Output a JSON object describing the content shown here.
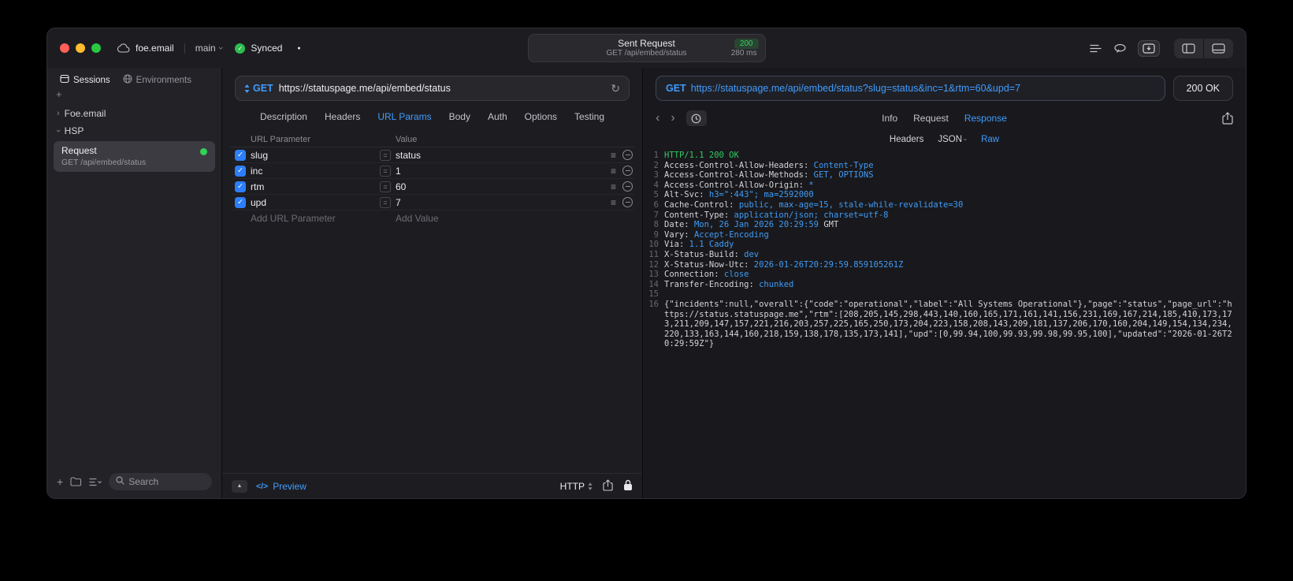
{
  "icons": {
    "plus": "+",
    "check": "✓",
    "chevron": "›",
    "refresh": "↻",
    "hamburger": "≡",
    "code": "</>",
    "collapse": "▲",
    "dot": "●",
    "equals": "="
  },
  "titlebar": {
    "project": "foe.email",
    "branch": "main",
    "sync_status": "Synced",
    "center": {
      "title": "Sent Request",
      "status_code": "200",
      "subtitle": "GET /api/embed/status",
      "duration": "280 ms"
    }
  },
  "sidebar": {
    "tabs": [
      {
        "label": "Sessions"
      },
      {
        "label": "Environments"
      }
    ],
    "tree": [
      {
        "label": "Foe.email"
      },
      {
        "label": "HSP"
      }
    ],
    "selected_request": {
      "name": "Request",
      "subtitle": "GET /api/embed/status"
    },
    "search_placeholder": "Search"
  },
  "request_panel": {
    "method": "GET",
    "url": "https://statuspage.me/api/embed/status",
    "tabs": [
      "Description",
      "Headers",
      "URL Params",
      "Body",
      "Auth",
      "Options",
      "Testing"
    ],
    "active_tab": "URL Params",
    "params": {
      "col_name": "URL Parameter",
      "col_value": "Value",
      "rows": [
        {
          "enabled": true,
          "name": "slug",
          "value": "status"
        },
        {
          "enabled": true,
          "name": "inc",
          "value": "1"
        },
        {
          "enabled": true,
          "name": "rtm",
          "value": "60"
        },
        {
          "enabled": true,
          "name": "upd",
          "value": "7"
        }
      ],
      "add_name": "Add URL Parameter",
      "add_value": "Add Value"
    },
    "footer": {
      "preview_label": "Preview",
      "protocol": "HTTP"
    }
  },
  "response_panel": {
    "method": "GET",
    "request_url": "https://statuspage.me/api/embed/status?slug=status&inc=1&rtm=60&upd=7",
    "status": "200 OK",
    "tabs": [
      "Info",
      "Request",
      "Response"
    ],
    "active_tab": "Response",
    "subtabs": [
      "Headers",
      "JSON",
      "Raw"
    ],
    "active_subtab": "Raw",
    "code": {
      "lines": [
        {
          "n": "1",
          "parts": [
            {
              "t": "HTTP/1.1 200 OK",
              "c": "green"
            }
          ]
        },
        {
          "n": "2",
          "parts": [
            {
              "t": "Access-Control-Allow-Headers: ",
              "c": "key"
            },
            {
              "t": "Content-Type",
              "c": "val"
            }
          ]
        },
        {
          "n": "3",
          "parts": [
            {
              "t": "Access-Control-Allow-Methods: ",
              "c": "key"
            },
            {
              "t": "GET, OPTIONS",
              "c": "val"
            }
          ]
        },
        {
          "n": "4",
          "parts": [
            {
              "t": "Access-Control-Allow-Origin: ",
              "c": "key"
            },
            {
              "t": "*",
              "c": "val"
            }
          ]
        },
        {
          "n": "5",
          "parts": [
            {
              "t": "Alt-Svc: ",
              "c": "key"
            },
            {
              "t": "h3=\":443\"; ma=2592000",
              "c": "val"
            }
          ]
        },
        {
          "n": "6",
          "parts": [
            {
              "t": "Cache-Control: ",
              "c": "key"
            },
            {
              "t": "public, max-age=15, stale-while-revalidate=30",
              "c": "val"
            }
          ]
        },
        {
          "n": "7",
          "parts": [
            {
              "t": "Content-Type: ",
              "c": "key"
            },
            {
              "t": "application/json; charset=utf-8",
              "c": "val"
            }
          ]
        },
        {
          "n": "8",
          "parts": [
            {
              "t": "Date: ",
              "c": "key"
            },
            {
              "t": "Mon, 26 Jan 2026 20:29:59 ",
              "c": "val"
            },
            {
              "t": "GMT",
              "c": "key"
            }
          ]
        },
        {
          "n": "9",
          "parts": [
            {
              "t": "Vary: ",
              "c": "key"
            },
            {
              "t": "Accept-Encoding",
              "c": "val"
            }
          ]
        },
        {
          "n": "10",
          "parts": [
            {
              "t": "Via: ",
              "c": "key"
            },
            {
              "t": "1.1 Caddy",
              "c": "val"
            }
          ]
        },
        {
          "n": "11",
          "parts": [
            {
              "t": "X-Status-Build: ",
              "c": "key"
            },
            {
              "t": "dev",
              "c": "val"
            }
          ]
        },
        {
          "n": "12",
          "parts": [
            {
              "t": "X-Status-Now-Utc: ",
              "c": "key"
            },
            {
              "t": "2026-01-26T20:29:59.859105261Z",
              "c": "val"
            }
          ]
        },
        {
          "n": "13",
          "parts": [
            {
              "t": "Connection: ",
              "c": "key"
            },
            {
              "t": "close",
              "c": "val"
            }
          ]
        },
        {
          "n": "14",
          "parts": [
            {
              "t": "Transfer-Encoding: ",
              "c": "key"
            },
            {
              "t": "chunked",
              "c": "val"
            }
          ]
        },
        {
          "n": "15",
          "parts": []
        },
        {
          "n": "16",
          "parts": [
            {
              "t": "{\"incidents\":null,\"overall\":{\"code\":\"operational\",\"label\":\"All Systems Operational\"},\"page\":\"status\",\"page_url\":\"https://status.statuspage.me\",\"rtm\":[208,205,145,298,443,140,160,165,171,161,141,156,231,169,167,214,185,410,173,173,211,209,147,157,221,216,203,257,225,165,250,173,204,223,158,208,143,209,181,137,206,170,160,204,149,154,134,234,220,133,163,144,160,218,159,138,178,135,173,141],\"upd\":[0,99.94,100,99.93,99.98,99.95,100],\"updated\":\"2026-01-26T20:29:59Z\"}",
              "c": "key"
            }
          ]
        }
      ]
    }
  },
  "colors": {
    "accent_blue": "#409cff",
    "success_green": "#32d158",
    "checkbox_blue": "#2d7ff9",
    "window_bg": "#1d1d21"
  }
}
